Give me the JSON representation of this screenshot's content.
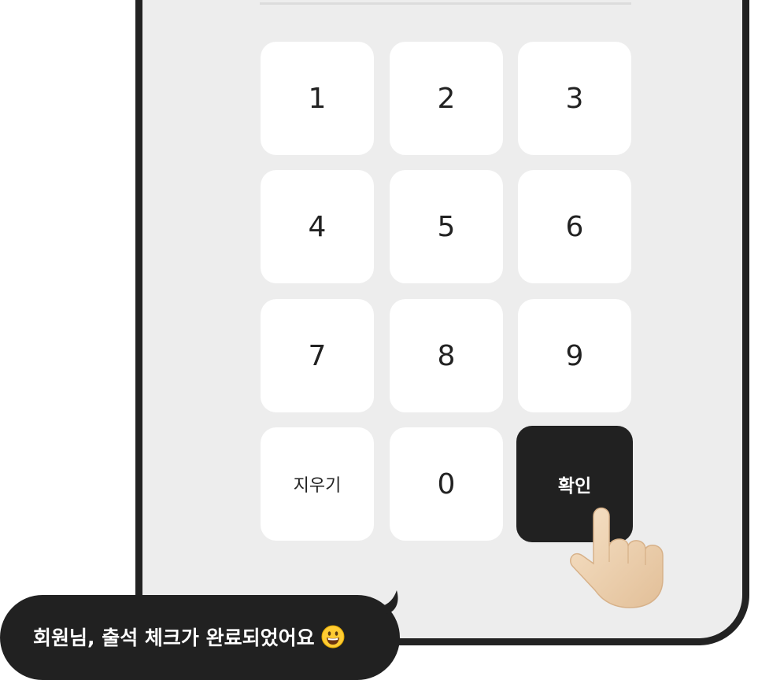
{
  "keypad": {
    "keys": [
      "1",
      "2",
      "3",
      "4",
      "5",
      "6",
      "7",
      "8",
      "9"
    ],
    "delete_label": "지우기",
    "zero": "0",
    "confirm_label": "확인"
  },
  "toast": {
    "message": "회원님, 출석 체크가 완료되었어요",
    "emoji_icon": "grinning-face-icon"
  },
  "colors": {
    "background": "#ededed",
    "key": "#ffffff",
    "confirm": "#212121",
    "frame": "#222222"
  }
}
